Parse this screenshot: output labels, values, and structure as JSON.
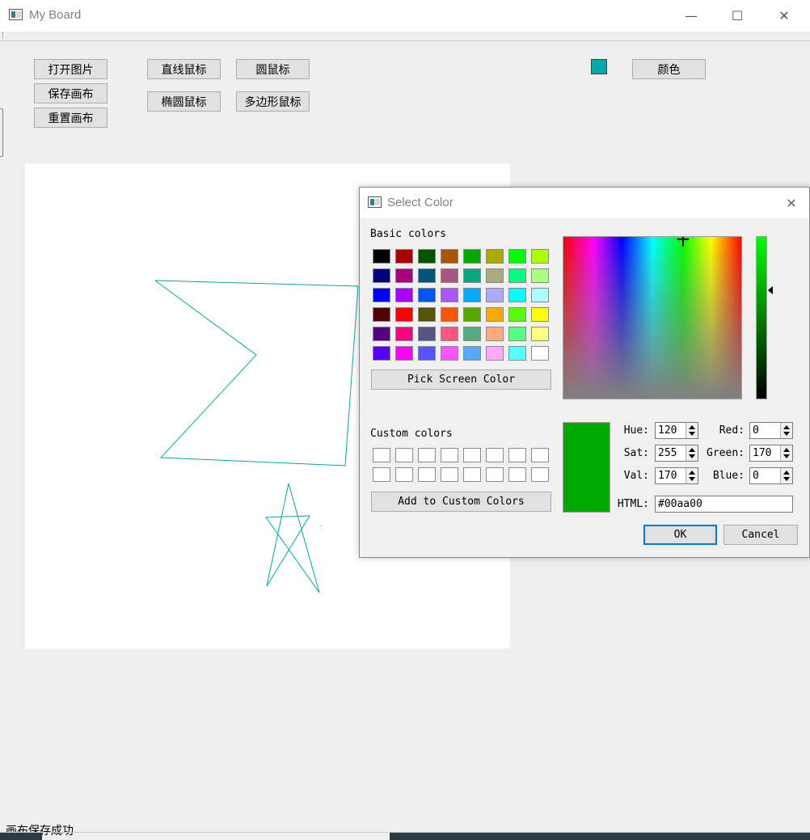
{
  "window": {
    "title": "My Board",
    "minimize_glyph": "—",
    "maximize_glyph": "☐",
    "close_glyph": "✕"
  },
  "toolbar": {
    "open_image": "打开图片",
    "save_canvas": "保存画布",
    "reset_canvas": "重置画布",
    "line_cursor": "直线鼠标",
    "ellipse_cursor": "椭圆鼠标",
    "circle_cursor": "圆鼠标",
    "polygon_cursor": "多边形鼠标",
    "color_button": "颜色",
    "current_color": "#00aaaa"
  },
  "canvas": {
    "stroke_color": "#00aaaa"
  },
  "status": {
    "message": "画布保存成功"
  },
  "dialog": {
    "title": "Select Color",
    "close_glyph": "✕",
    "basic_colors_label": "Basic colors",
    "basic_colors": [
      [
        "#000000",
        "#aa0000",
        "#005500",
        "#aa5500",
        "#00aa00",
        "#aaaa00",
        "#00ff00",
        "#aaff00"
      ],
      [
        "#00007f",
        "#aa007f",
        "#00557f",
        "#aa557f",
        "#00aa7f",
        "#aaaa7f",
        "#00ff7f",
        "#aaff7f"
      ],
      [
        "#0000ff",
        "#aa00ff",
        "#0055ff",
        "#aa55ff",
        "#00aaff",
        "#aaaaff",
        "#00ffff",
        "#aaffff"
      ],
      [
        "#550000",
        "#ff0000",
        "#555500",
        "#ff5500",
        "#55aa00",
        "#ffaa00",
        "#55ff00",
        "#ffff00"
      ],
      [
        "#55007f",
        "#ff007f",
        "#55557f",
        "#ff557f",
        "#55aa7f",
        "#ffaa7f",
        "#55ff7f",
        "#ffff7f"
      ],
      [
        "#5500ff",
        "#ff00ff",
        "#5555ff",
        "#ff55ff",
        "#55aaff",
        "#ffaaff",
        "#55ffff",
        "#ffffff"
      ]
    ],
    "pick_screen_color": "Pick Screen Color",
    "custom_colors_label": "Custom colors",
    "add_custom": "Add to Custom Colors",
    "selected_color": "#00aa00",
    "fields": {
      "hue_label": "Hue:",
      "hue": "120",
      "sat_label": "Sat:",
      "sat": "255",
      "val_label": "Val:",
      "val": "170",
      "red_label": "Red:",
      "red": "0",
      "green_label": "Green:",
      "green": "170",
      "blue_label": "Blue:",
      "blue": "0",
      "html_label": "HTML:",
      "html": "#00aa00"
    },
    "ok": "OK",
    "cancel": "Cancel"
  }
}
